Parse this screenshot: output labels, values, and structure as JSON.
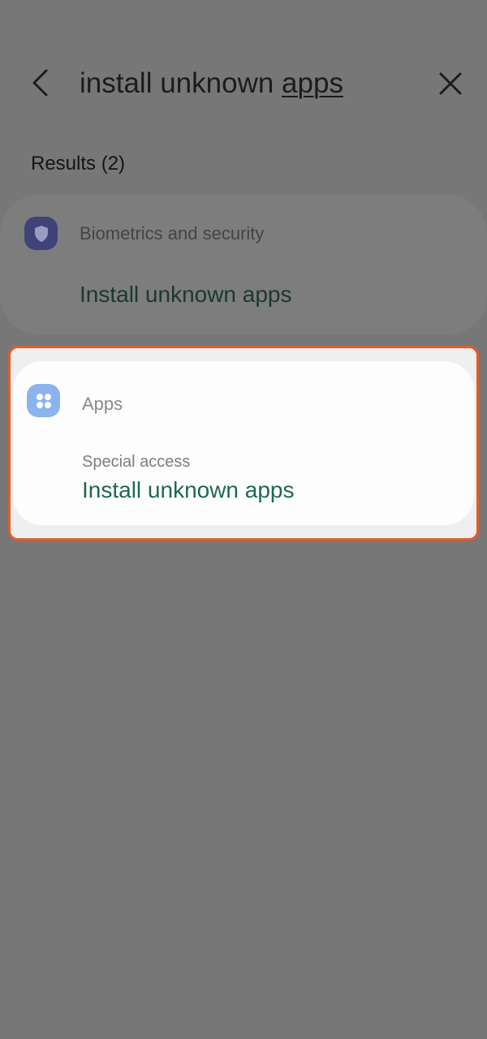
{
  "search": {
    "query_prefix": "install unknown ",
    "query_match": "apps"
  },
  "results": {
    "count_label": "Results (2)",
    "items": [
      {
        "category": "Biometrics and security",
        "title": "Install unknown apps",
        "icon": "shield-icon",
        "icon_color": "#3f4378"
      },
      {
        "category": "Apps",
        "subcategory": "Special access",
        "title": "Install unknown apps",
        "icon": "apps-grid-icon",
        "icon_color": "#8bb4ee"
      }
    ]
  },
  "colors": {
    "scrim": "#777777",
    "title_green": "#1e6a4c",
    "highlight_border": "#e25c2a"
  }
}
